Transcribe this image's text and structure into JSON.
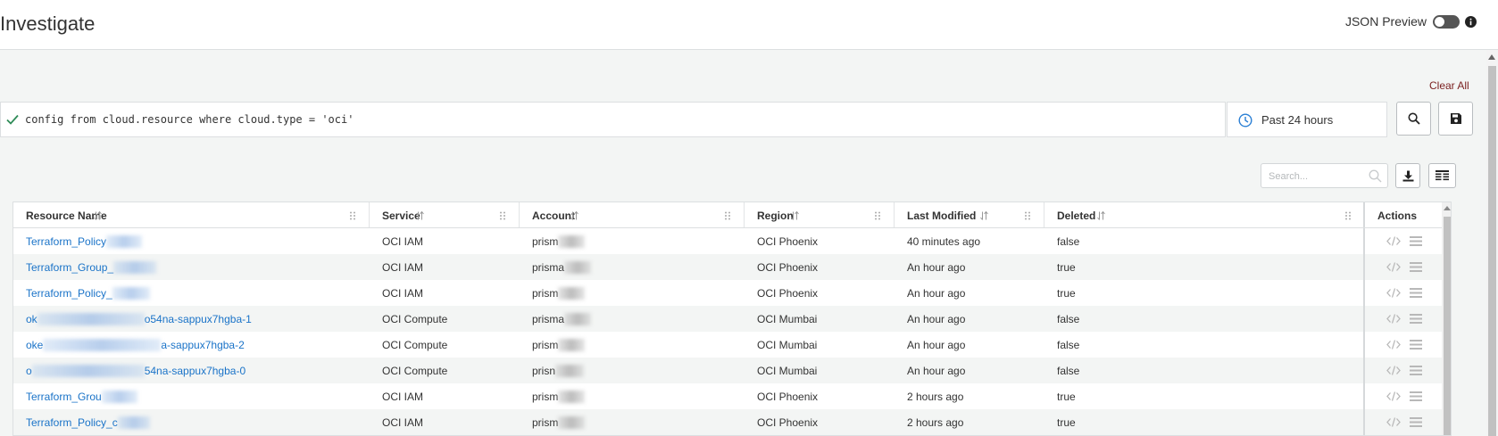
{
  "header": {
    "title": "Investigate",
    "json_preview_label": "JSON Preview",
    "json_preview_enabled": false
  },
  "query": {
    "clear_all_label": "Clear All",
    "text": "config from cloud.resource where cloud.type = 'oci'",
    "status": "valid",
    "time_range": "Past 24 hours"
  },
  "table": {
    "search_placeholder": "Search...",
    "columns": [
      "Resource Name",
      "Service",
      "Account",
      "Region",
      "Last Modified",
      "Deleted"
    ],
    "actions_label": "Actions",
    "rows": [
      {
        "name": "Terraform_Policy",
        "service": "OCI IAM",
        "account": "prism",
        "region": "OCI Phoenix",
        "modified": "40 minutes ago",
        "deleted": "false"
      },
      {
        "name": "Terraform_Group_",
        "service": "OCI IAM",
        "account": "prisma",
        "region": "OCI Phoenix",
        "modified": "An hour ago",
        "deleted": "true"
      },
      {
        "name": "Terraform_Policy_",
        "service": "OCI IAM",
        "account": "prism",
        "region": "OCI Phoenix",
        "modified": "An hour ago",
        "deleted": "true"
      },
      {
        "name": "ok",
        "name_suffix": "o54na-sappux7hgba-1",
        "service": "OCI Compute",
        "account": "prisma",
        "region": "OCI Mumbai",
        "modified": "An hour ago",
        "deleted": "false"
      },
      {
        "name": "oke",
        "name_suffix": "a-sappux7hgba-2",
        "service": "OCI Compute",
        "account": "prism",
        "region": "OCI Mumbai",
        "modified": "An hour ago",
        "deleted": "false"
      },
      {
        "name": "o",
        "name_suffix": "54na-sappux7hgba-0",
        "service": "OCI Compute",
        "account": "prisn",
        "region": "OCI Mumbai",
        "modified": "An hour ago",
        "deleted": "false"
      },
      {
        "name": "Terraform_Grou",
        "service": "OCI IAM",
        "account": "prism",
        "region": "OCI Phoenix",
        "modified": "2 hours ago",
        "deleted": "true"
      },
      {
        "name": "Terraform_Policy_c",
        "service": "OCI IAM",
        "account": "prism",
        "region": "OCI Phoenix",
        "modified": "2 hours ago",
        "deleted": "true"
      }
    ]
  },
  "icons": {
    "query_status": "check-icon",
    "time": "clock-icon",
    "run_query": "search-icon",
    "save_query": "save-icon",
    "download": "download-icon",
    "columns": "columns-icon",
    "row_json": "code-icon",
    "row_menu": "menu-icon"
  },
  "colors": {
    "link": "#1a73c8",
    "valid_check": "#2e8b57",
    "clock": "#2a7fd4",
    "clear_all": "#7a1f1f"
  }
}
